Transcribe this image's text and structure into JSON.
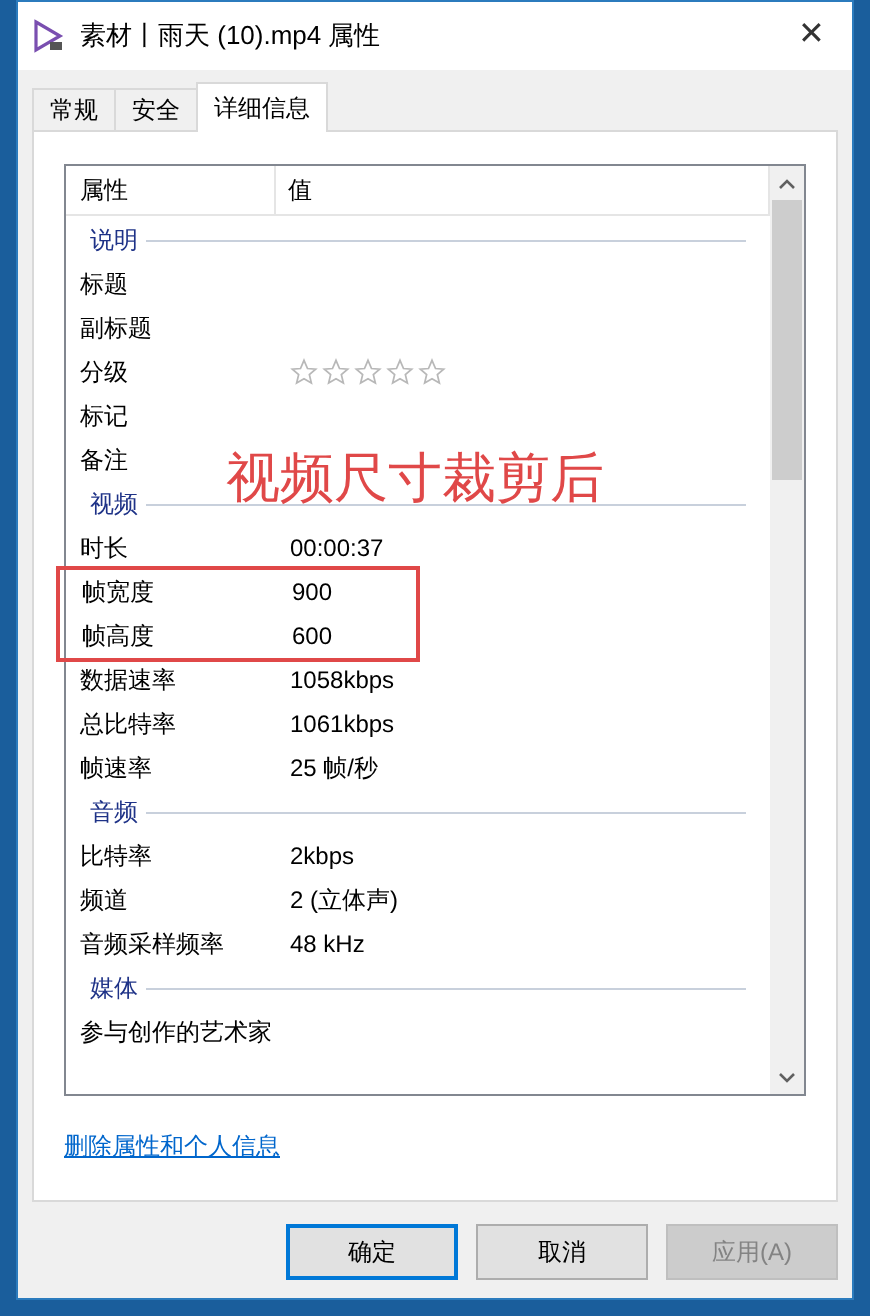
{
  "window": {
    "title": "素材丨雨天 (10).mp4 属性",
    "close": "✕"
  },
  "tabs": [
    {
      "label": "常规",
      "selected": false
    },
    {
      "label": "安全",
      "selected": false
    },
    {
      "label": "详细信息",
      "selected": true
    }
  ],
  "columns": [
    "属性",
    "值"
  ],
  "rows": [
    {
      "kind": "section",
      "label": "说明"
    },
    {
      "kind": "prop",
      "name": "标题",
      "boxed": false
    },
    {
      "kind": "prop",
      "name": "副标题",
      "boxed": false
    },
    {
      "kind": "rating",
      "name": "分级",
      "stars": 0
    },
    {
      "kind": "prop",
      "name": "标记",
      "boxed": false
    },
    {
      "kind": "prop",
      "name": "备注",
      "boxed": false
    },
    {
      "kind": "section",
      "label": "视频"
    },
    {
      "kind": "prop",
      "name": "时长",
      "value": "00:00:37",
      "boxed": false
    },
    {
      "kind": "prop",
      "name": "帧宽度",
      "value": "900",
      "boxed": true
    },
    {
      "kind": "prop",
      "name": "帧高度",
      "value": "600",
      "boxed": true
    },
    {
      "kind": "prop",
      "name": "数据速率",
      "value": "1058kbps",
      "boxed": false
    },
    {
      "kind": "prop",
      "name": "总比特率",
      "value": "1061kbps",
      "boxed": false
    },
    {
      "kind": "prop",
      "name": "帧速率",
      "value": "25 帧/秒",
      "boxed": false
    },
    {
      "kind": "section",
      "label": "音频"
    },
    {
      "kind": "prop",
      "name": "比特率",
      "value": "2kbps",
      "boxed": false
    },
    {
      "kind": "prop",
      "name": "频道",
      "value": "2 (立体声)",
      "boxed": false
    },
    {
      "kind": "prop",
      "name": "音频采样频率",
      "value": "48 kHz",
      "boxed": false
    },
    {
      "kind": "section",
      "label": "媒体"
    },
    {
      "kind": "prop",
      "name": "参与创作的艺术家",
      "boxed": false
    }
  ],
  "annotation": "视频尺寸裁剪后",
  "link": "删除属性和个人信息",
  "buttons": [
    {
      "label": "确定",
      "disabled": false,
      "default": true
    },
    {
      "label": "取消",
      "disabled": false,
      "default": false
    },
    {
      "label": "应用(A)",
      "disabled": true,
      "default": false
    }
  ]
}
